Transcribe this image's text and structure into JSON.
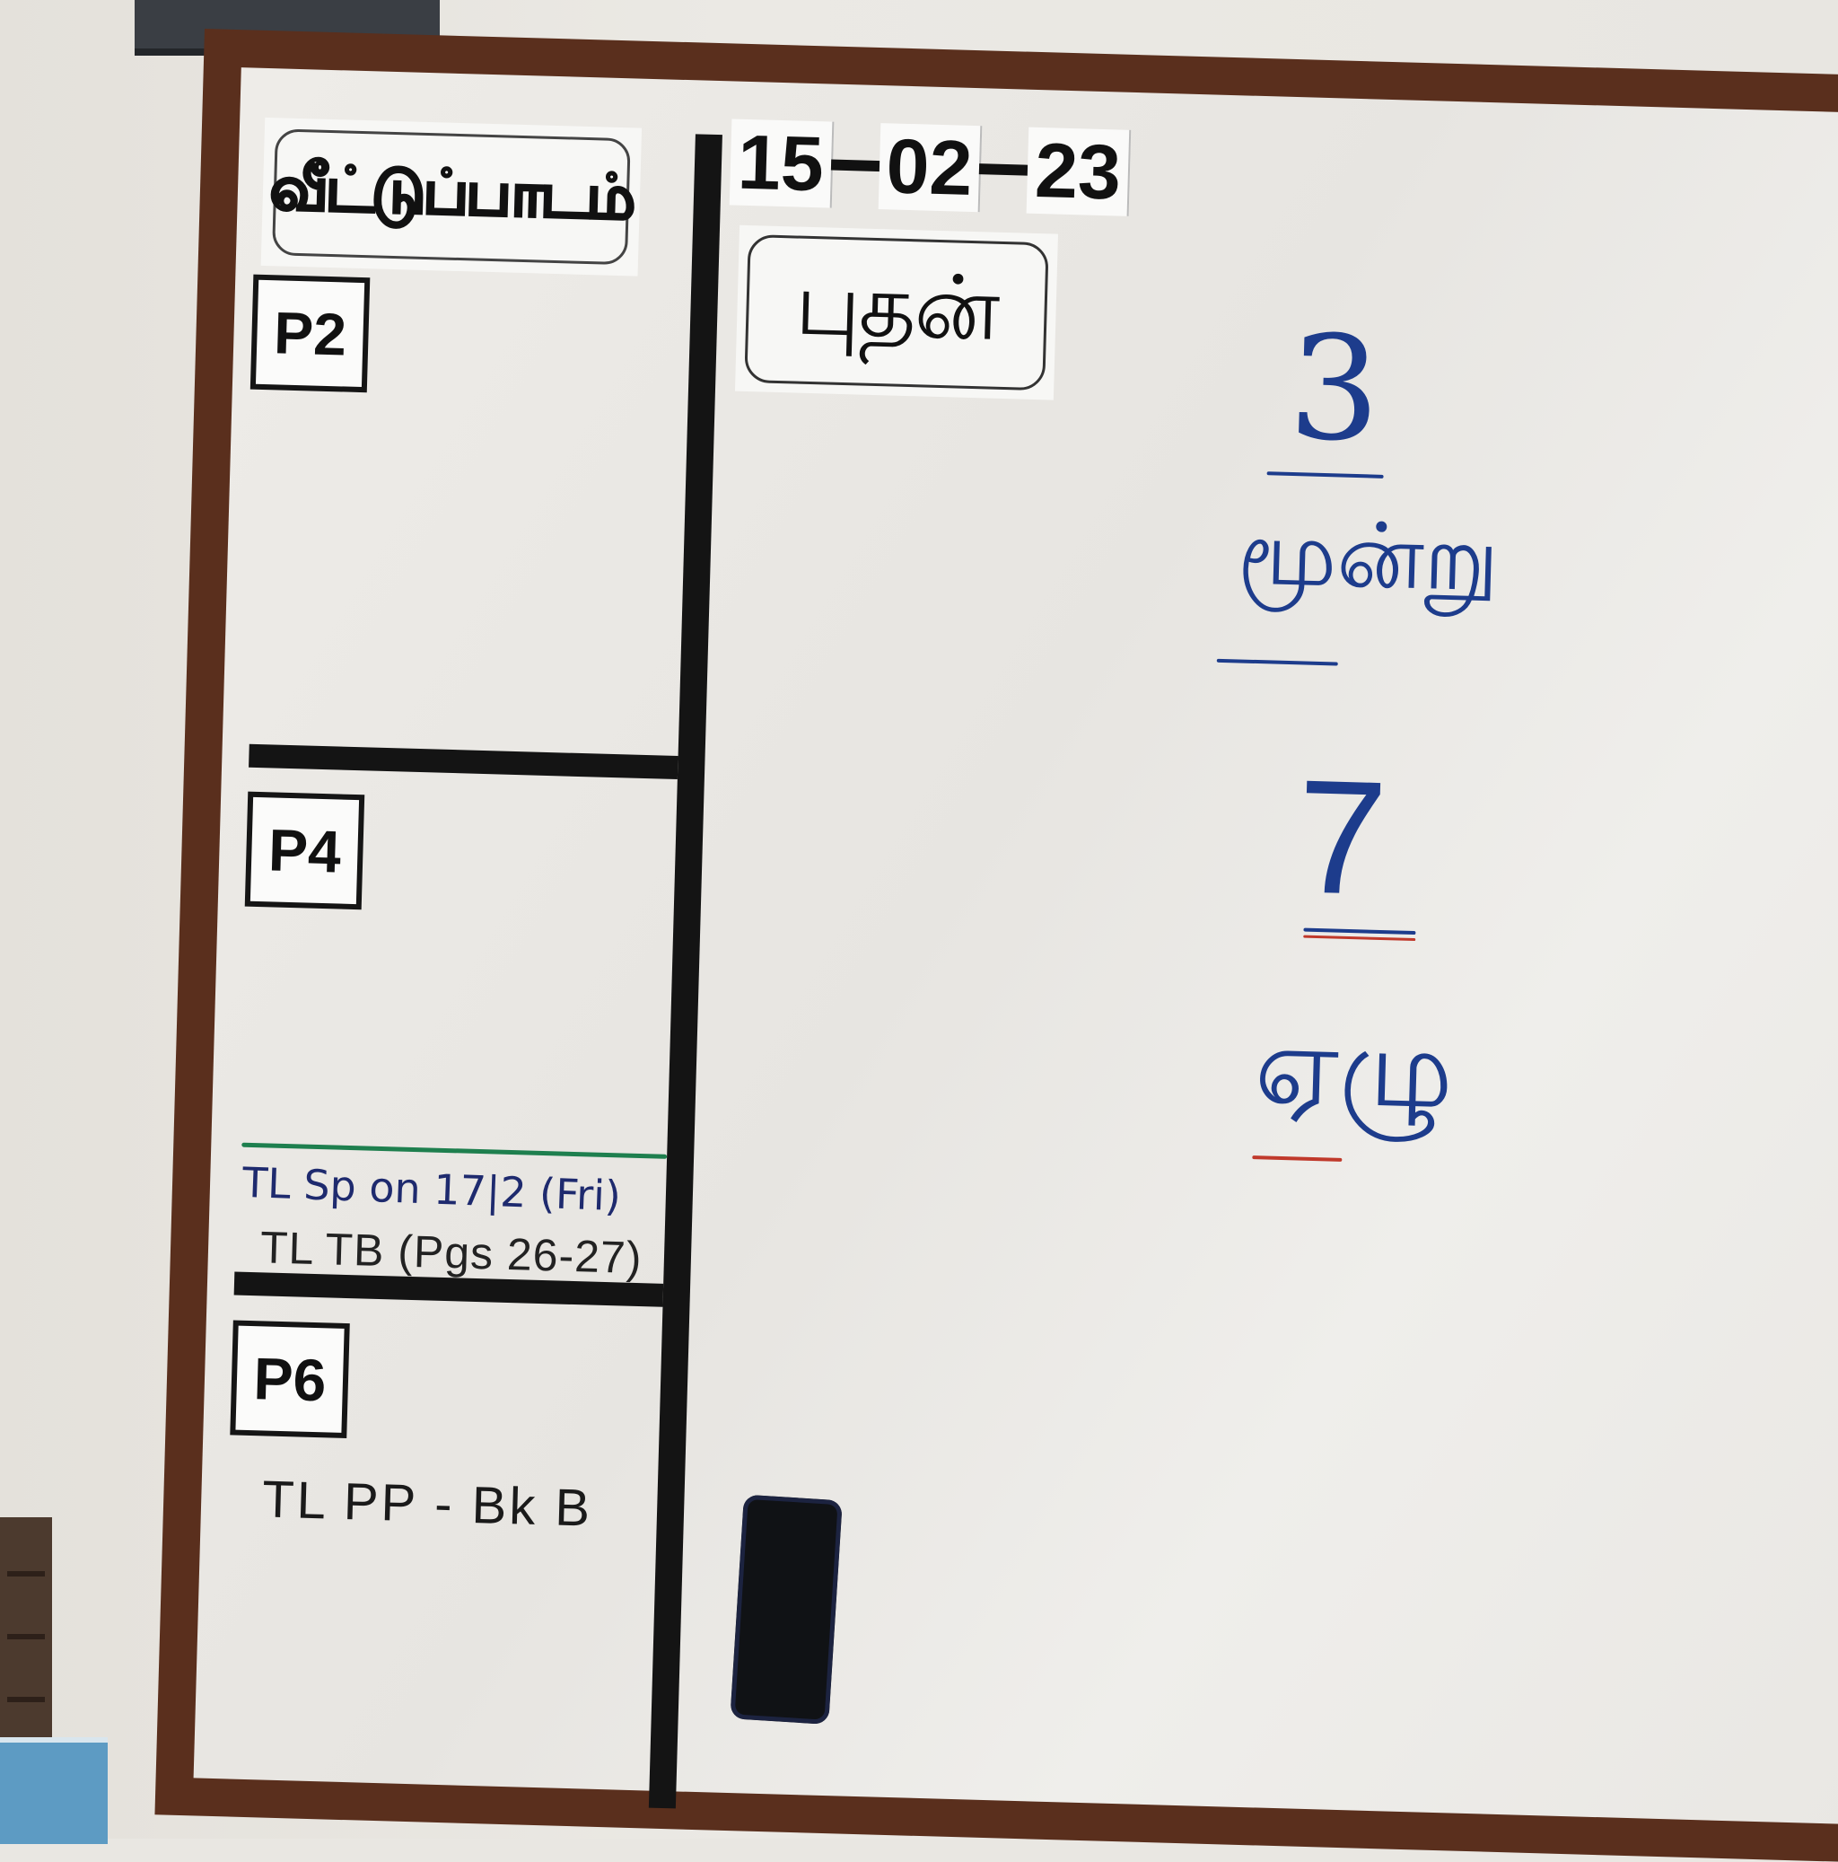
{
  "board": {
    "header_title": "வீட்டுப்பாடம்",
    "date": {
      "day": "15",
      "month": "02",
      "year": "23"
    },
    "weekday": "புதன்",
    "sections": [
      {
        "label": "P2",
        "note": ""
      },
      {
        "label": "P4",
        "note": "TL Sp on 17|2 (Fri)\nTL TB (Pgs 26-27)"
      },
      {
        "label": "P6",
        "note": "TL PP - Bk B"
      }
    ],
    "p4_note_line1": "TL Sp on 17|2 (Fri)",
    "p4_note_line2": "TL TB (Pgs 26-27)",
    "p6_note": "TL PP - Bk B",
    "lesson": {
      "number_1": "3",
      "word_1": "மூன்று",
      "number_2": "7",
      "word_2": "ஏழு"
    }
  },
  "colors": {
    "frame": "#5a2f1d",
    "board": "#eeece8",
    "tape": "#141414",
    "marker_blue": "#1d3c8c",
    "marker_green": "#1e7f4e",
    "marker_red": "#c0392b"
  }
}
